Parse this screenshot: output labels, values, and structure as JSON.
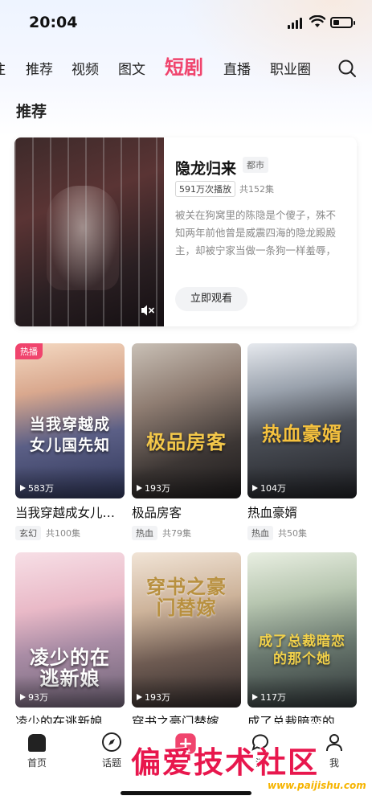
{
  "status_bar": {
    "time": "20:04"
  },
  "tabs": [
    {
      "label": "推荐",
      "active": false
    },
    {
      "label": "视频",
      "active": false
    },
    {
      "label": "图文",
      "active": false
    },
    {
      "label": "短剧",
      "active": true
    },
    {
      "label": "直播",
      "active": false
    },
    {
      "label": "职业圈",
      "active": false
    }
  ],
  "tab_partial": "注",
  "section_title": "推荐",
  "featured": {
    "title": "隐龙归来",
    "genre": "都市",
    "plays": "591万次播放",
    "episodes": "共152集",
    "description": "被关在狗窝里的陈隐是个傻子，殊不知两年前他曾是威震四海的隐龙殿殿主，却被宁家当做一条狗一样羞辱，直到贴心照顾他…",
    "watch_label": "立即观看"
  },
  "grid": [
    {
      "title": "当我穿越成女儿…",
      "cover_text": "当我穿越成女儿国先知",
      "plays": "583万",
      "genre": "玄幻",
      "episodes": "共100集",
      "badge": "热播"
    },
    {
      "title": "极品房客",
      "cover_text": "极品房客",
      "plays": "193万",
      "genre": "热血",
      "episodes": "共79集",
      "badge": ""
    },
    {
      "title": "热血豪婿",
      "cover_text": "热血豪婿",
      "plays": "104万",
      "genre": "热血",
      "episodes": "共50集",
      "badge": ""
    },
    {
      "title": "凌少的在逃新娘",
      "cover_text": "凌少的在逃新娘",
      "plays": "93万",
      "genre": "",
      "episodes": "",
      "badge": ""
    },
    {
      "title": "穿书之豪门替嫁",
      "cover_text": "穿书之豪门替嫁",
      "plays": "193万",
      "genre": "",
      "episodes": "",
      "badge": ""
    },
    {
      "title": "成了总裁暗恋的…",
      "cover_text": "成了总裁暗恋的那个她",
      "plays": "117万",
      "genre": "",
      "episodes": "",
      "badge": ""
    }
  ],
  "bottom_nav": [
    {
      "label": "首页",
      "icon": "home-icon"
    },
    {
      "label": "话题",
      "icon": "compass-icon"
    },
    {
      "label": "",
      "icon": "publish-icon"
    },
    {
      "label": "消",
      "icon": "message-icon"
    },
    {
      "label": "我",
      "icon": "profile-icon"
    }
  ],
  "watermark": {
    "main": "偏爱技术社区",
    "url": "www.paijishu.com"
  },
  "colors": {
    "accent": "#f0446d",
    "watermark_red": "#e8174d",
    "watermark_gold": "#f6b400"
  }
}
